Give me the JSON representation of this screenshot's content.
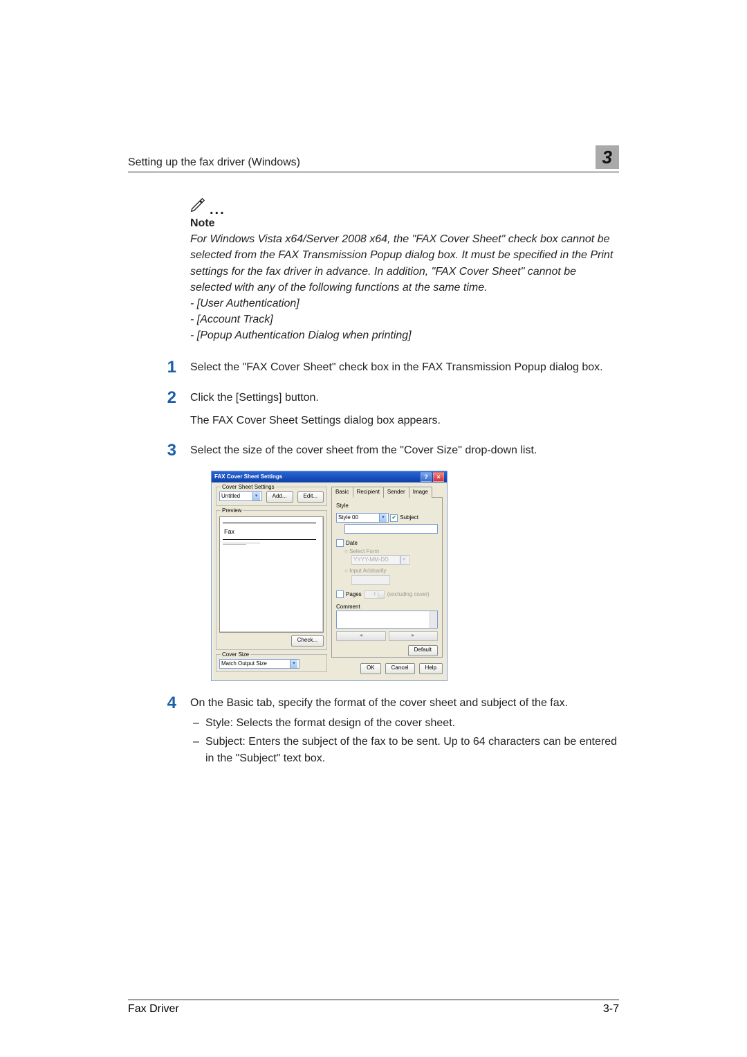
{
  "header": {
    "title": "Setting up the fax driver (Windows)",
    "chapter": "3"
  },
  "note": {
    "label": "Note",
    "body": "For Windows Vista x64/Server 2008 x64, the \"FAX Cover Sheet\" check box cannot be selected from the FAX Transmission Popup dialog box. It must be specified in the Print settings for the fax driver in advance. In addition, \"FAX Cover Sheet\" cannot be selected with any of the following functions at the same time.",
    "items": [
      "- [User Authentication]",
      "- [Account Track]",
      "- [Popup Authentication Dialog when printing]"
    ]
  },
  "steps": [
    {
      "num": "1",
      "text": "Select the \"FAX Cover Sheet\" check box in the FAX Transmission Popup dialog box."
    },
    {
      "num": "2",
      "text": "Click the [Settings] button.",
      "sub": "The FAX Cover Sheet Settings dialog box appears."
    },
    {
      "num": "3",
      "text": "Select the size of the cover sheet from the \"Cover Size\" drop-down list."
    },
    {
      "num": "4",
      "text": "On the Basic tab, specify the format of the cover sheet and subject of the fax.",
      "bullets": [
        "Style: Selects the format design of the cover sheet.",
        "Subject: Enters the subject of the fax to be sent. Up to 64 characters can be entered in the \"Subject\" text box."
      ]
    }
  ],
  "dialog": {
    "title": "FAX Cover Sheet Settings",
    "cover_sheet_settings": "Cover Sheet Settings",
    "untitled": "Untitled",
    "add": "Add...",
    "edit": "Edit...",
    "preview": "Preview",
    "fax_label": "Fax",
    "check": "Check...",
    "cover_size": "Cover Size",
    "match_output": "Match Output Size",
    "tabs": [
      "Basic",
      "Recipient",
      "Sender",
      "Image"
    ],
    "style": "Style",
    "style_value": "Style 00",
    "subject": "Subject",
    "date": "Date",
    "select_form": "Select Form",
    "date_format": "YYYY-MM-DD",
    "input_arbitrarily": "Input Arbitrarily",
    "pages": "Pages",
    "pages_suffix": "(excluding cover)",
    "pages_value": "1",
    "comment": "Comment",
    "default": "Default",
    "ok": "OK",
    "cancel": "Cancel",
    "help": "Help"
  },
  "footer": {
    "left": "Fax Driver",
    "right": "3-7"
  }
}
